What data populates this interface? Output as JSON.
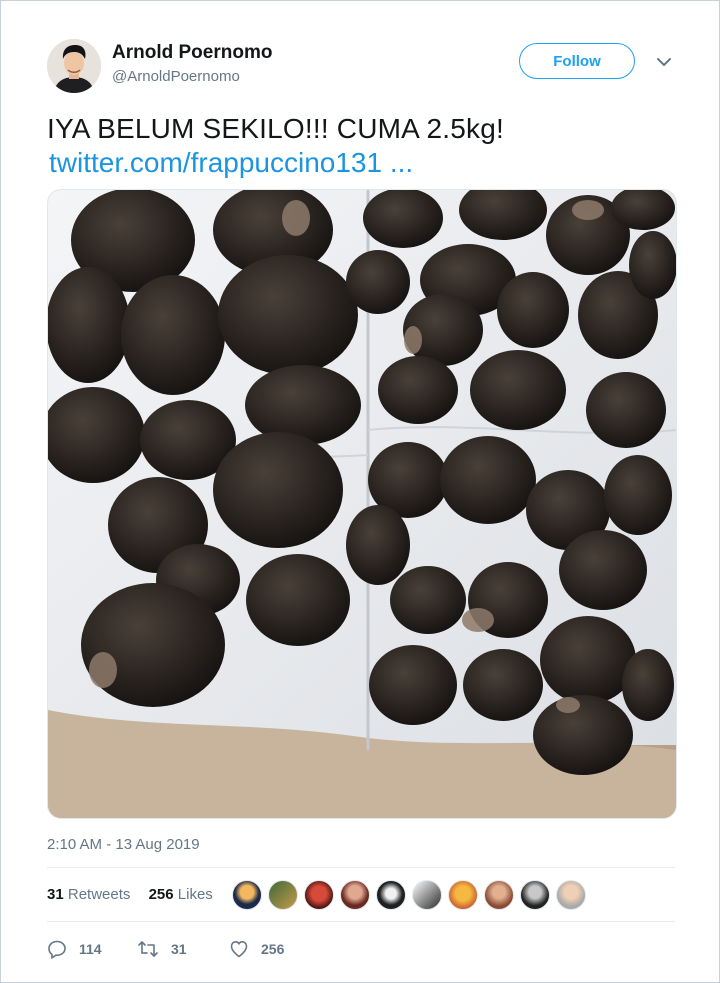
{
  "tweet": {
    "author_name": "Arnold Poernomo",
    "author_handle": "@ArnoldPoernomo",
    "follow_label": "Follow",
    "text": "IYA BELUM SEKILO!!! CUMA 2.5kg!",
    "link_text": "twitter.com/frappuccino131 ...",
    "timestamp": "2:10 AM - 13 Aug 2019"
  },
  "stats": {
    "retweets_count": "31",
    "retweets_label": "Retweets",
    "likes_count": "256",
    "likes_label": "Likes"
  },
  "actions": {
    "reply_count": "114",
    "retweet_count": "31",
    "like_count": "256"
  },
  "colors": {
    "accent": "#1da1f2",
    "link": "#1b95e0",
    "muted": "#657786"
  },
  "icons": [
    "chevron-down-icon",
    "reply-icon",
    "retweet-icon",
    "heart-icon"
  ]
}
